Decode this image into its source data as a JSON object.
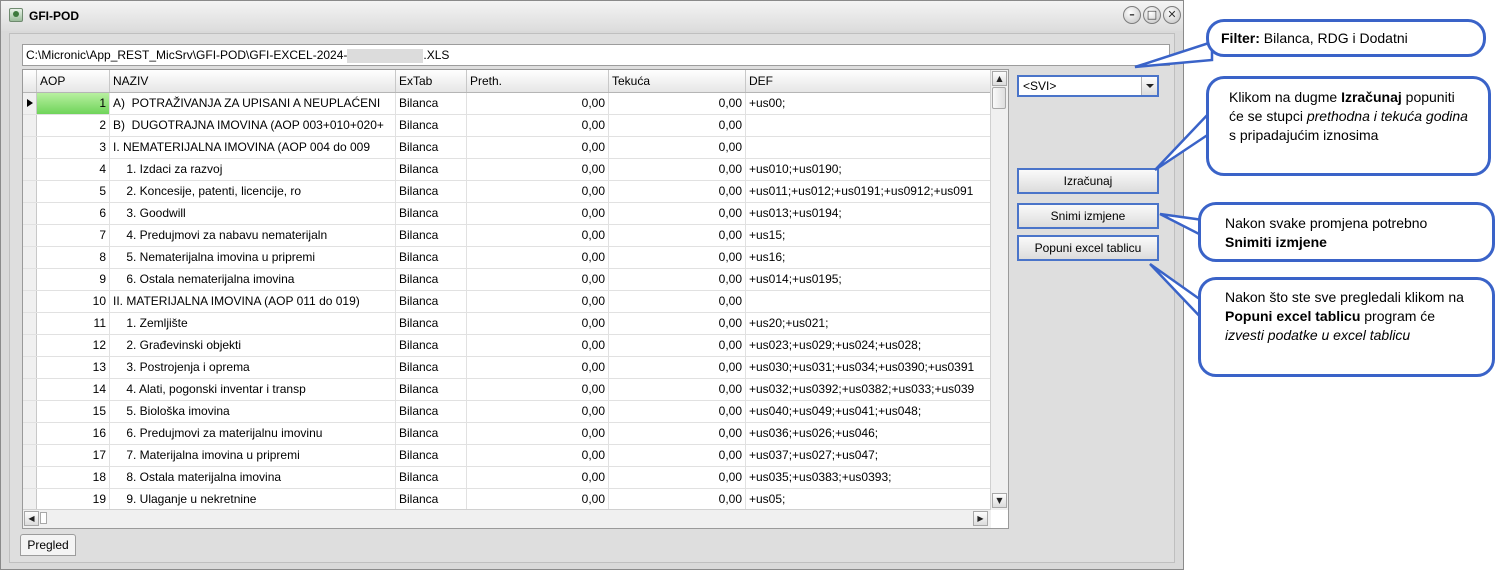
{
  "window": {
    "title": "GFI-POD",
    "minimize": "–",
    "maximize": "□",
    "close": "✕"
  },
  "path": {
    "prefix": "C:\\Micronic\\App_REST_MicSrv\\GFI-POD\\GFI-EXCEL-2024-",
    "suffix": ".XLS"
  },
  "grid": {
    "columns": [
      "AOP",
      "NAZIV",
      "ExTab",
      "Preth.",
      "Tekuća",
      "DEF"
    ],
    "rows": [
      [
        "1",
        "A)  POTRAŽIVANJA ZA UPISANI A NEUPLAĆENI",
        "Bilanca",
        "0,00",
        "0,00",
        "+us00;"
      ],
      [
        "2",
        "B)  DUGOTRAJNA IMOVINA (AOP 003+010+020+",
        "Bilanca",
        "0,00",
        "0,00",
        ""
      ],
      [
        "3",
        "I. NEMATERIJALNA IMOVINA (AOP 004 do 009",
        "Bilanca",
        "0,00",
        "0,00",
        ""
      ],
      [
        "4",
        "    1. Izdaci za razvoj",
        "Bilanca",
        "0,00",
        "0,00",
        "+us010;+us0190;"
      ],
      [
        "5",
        "    2. Koncesije, patenti, licencije, ro",
        "Bilanca",
        "0,00",
        "0,00",
        "+us011;+us012;+us0191;+us0912;+us091"
      ],
      [
        "6",
        "    3. Goodwill",
        "Bilanca",
        "0,00",
        "0,00",
        "+us013;+us0194;"
      ],
      [
        "7",
        "    4. Predujmovi za nabavu nematerijaln",
        "Bilanca",
        "0,00",
        "0,00",
        "+us15;"
      ],
      [
        "8",
        "    5. Nematerijalna imovina u pripremi",
        "Bilanca",
        "0,00",
        "0,00",
        "+us16;"
      ],
      [
        "9",
        "    6. Ostala nematerijalna imovina",
        "Bilanca",
        "0,00",
        "0,00",
        "+us014;+us0195;"
      ],
      [
        "10",
        "II. MATERIJALNA IMOVINA (AOP 011 do 019)",
        "Bilanca",
        "0,00",
        "0,00",
        ""
      ],
      [
        "11",
        "    1. Zemljište",
        "Bilanca",
        "0,00",
        "0,00",
        "+us20;+us021;"
      ],
      [
        "12",
        "    2. Građevinski objekti",
        "Bilanca",
        "0,00",
        "0,00",
        "+us023;+us029;+us024;+us028;"
      ],
      [
        "13",
        "    3. Postrojenja i oprema",
        "Bilanca",
        "0,00",
        "0,00",
        "+us030;+us031;+us034;+us0390;+us0391"
      ],
      [
        "14",
        "    4. Alati, pogonski inventar i transp",
        "Bilanca",
        "0,00",
        "0,00",
        "+us032;+us0392;+us0382;+us033;+us039"
      ],
      [
        "15",
        "    5. Biološka imovina",
        "Bilanca",
        "0,00",
        "0,00",
        "+us040;+us049;+us041;+us048;"
      ],
      [
        "16",
        "    6. Predujmovi za materijalnu imovinu",
        "Bilanca",
        "0,00",
        "0,00",
        "+us036;+us026;+us046;"
      ],
      [
        "17",
        "    7. Materijalna imovina u pripremi",
        "Bilanca",
        "0,00",
        "0,00",
        "+us037;+us027;+us047;"
      ],
      [
        "18",
        "    8. Ostala materijalna imovina",
        "Bilanca",
        "0,00",
        "0,00",
        "+us035;+us0383;+us0393;"
      ],
      [
        "19",
        "    9. Ulaganje u nekretnine",
        "Bilanca",
        "0,00",
        "0,00",
        "+us05;"
      ]
    ]
  },
  "filter": {
    "value": "<SVI>"
  },
  "buttons": {
    "calculate": "Izračunaj",
    "save": "Snimi izmjene",
    "export": "Popuni excel tablicu"
  },
  "tab": {
    "label": "Pregled"
  },
  "callouts": {
    "filter": {
      "bold": "Filter:",
      "text": " Bilanca, RDG i Dodatni"
    },
    "calc": {
      "t1": "Klikom na dugme ",
      "b1": "Izračunaj",
      "t2": " popuniti će se stupci ",
      "i1": "prethodna i tekuća godina",
      "t3": " s pripadajućim iznosima"
    },
    "save": {
      "t1": "Nakon svake promjena potrebno ",
      "b1": "Snimiti izmjene"
    },
    "export": {
      "t1": "Nakon što ste sve pregledali klikom na ",
      "b1": "Popuni excel tablicu",
      "t2": " program će ",
      "i1": "izvesti podatke u excel tablicu"
    }
  }
}
